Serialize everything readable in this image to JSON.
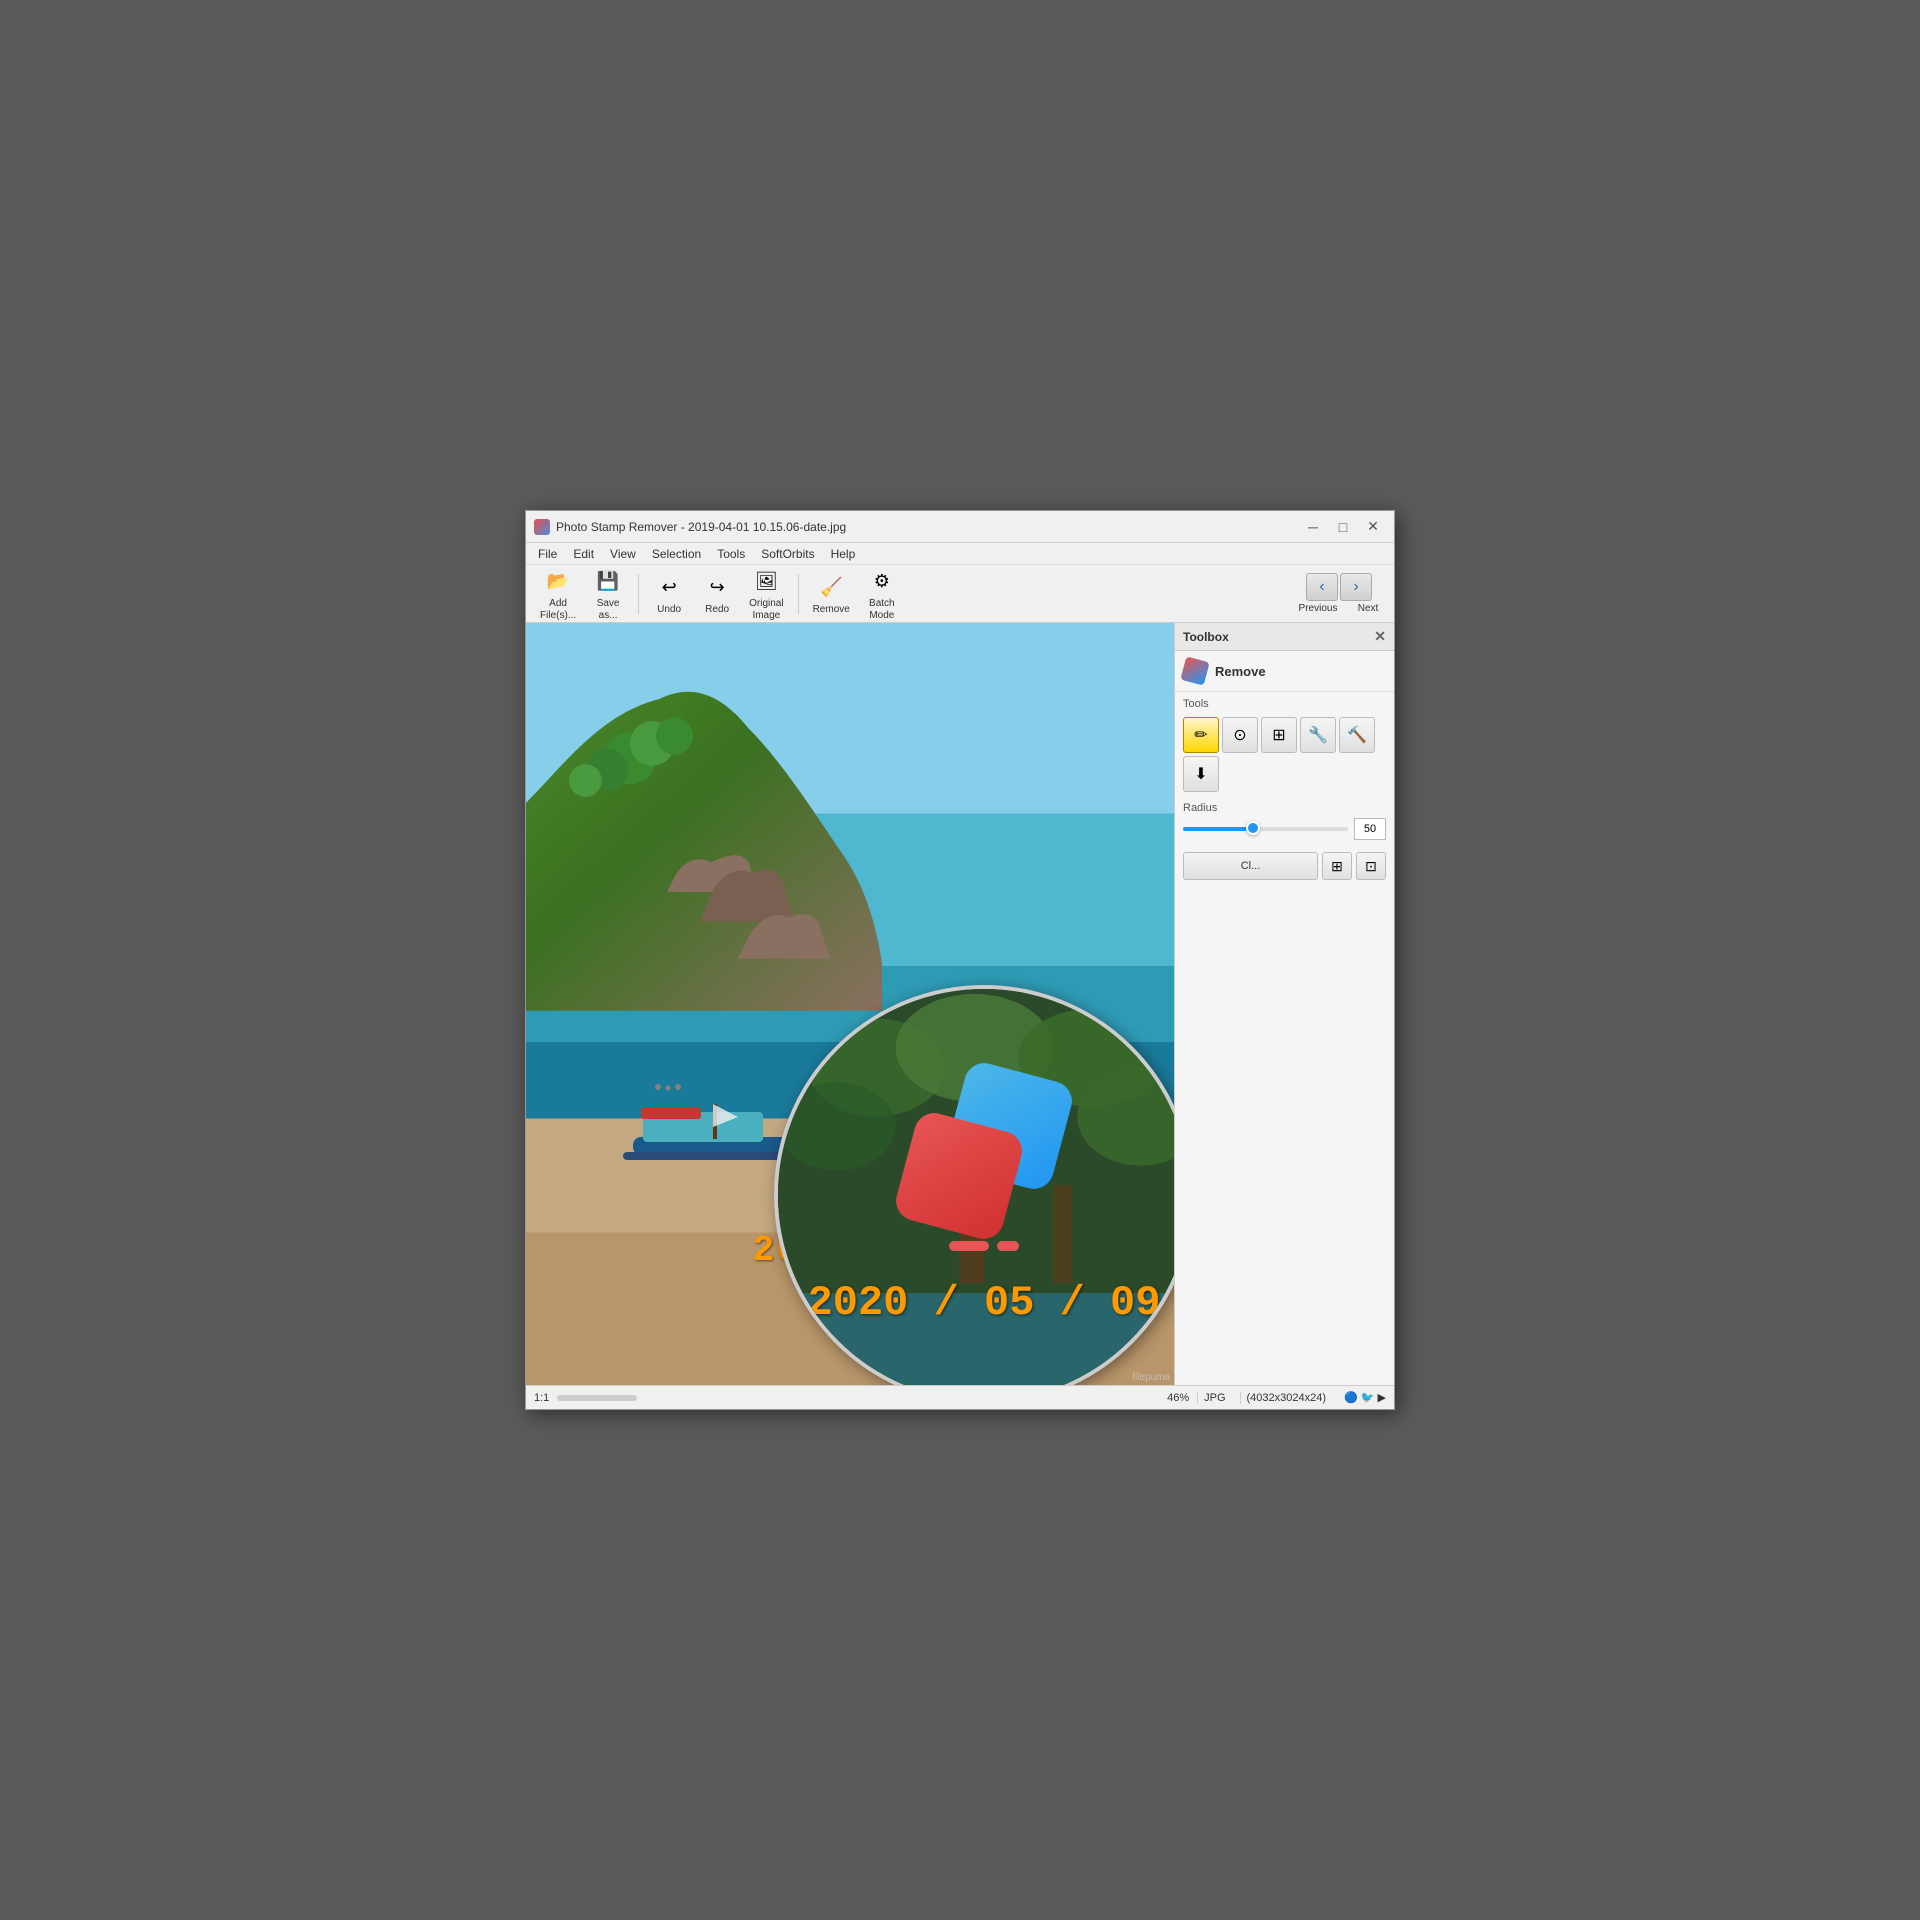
{
  "app": {
    "title": "Photo Stamp Remover - 2019-04-01 10.15.06-date.jpg",
    "icon": "eraser-icon"
  },
  "title_bar": {
    "minimize": "─",
    "maximize": "□",
    "close": "✕"
  },
  "menu": {
    "items": [
      "File",
      "Edit",
      "View",
      "Selection",
      "Tools",
      "SoftOrbits",
      "Help"
    ]
  },
  "toolbar": {
    "add_label": "Add\nFile(s)...",
    "save_label": "Save\nas...",
    "undo_label": "Undo",
    "redo_label": "Redo",
    "original_label": "Original\nImage",
    "remove_label": "Remove",
    "batch_label": "Batch\nMode",
    "previous_label": "Previous",
    "next_label": "Next"
  },
  "toolbox": {
    "title": "Toolbox",
    "remove_heading": "Remove",
    "tools_label": "Tools",
    "radius_label": "Radius",
    "radius_value": "50",
    "clear_btn": "Cl...",
    "tools": [
      {
        "name": "pencil",
        "symbol": "✏️",
        "active": true
      },
      {
        "name": "lasso",
        "symbol": "⭕",
        "active": false
      },
      {
        "name": "grid",
        "symbol": "⊞",
        "active": false
      },
      {
        "name": "fill",
        "symbol": "🔧",
        "active": false
      },
      {
        "name": "stamp",
        "symbol": "🔨",
        "active": false
      },
      {
        "name": "clone",
        "symbol": "⬇",
        "active": false
      }
    ]
  },
  "image": {
    "date_stamp": "2020 / 05 / 09",
    "date_stamp_partial": "2020 / 05 /"
  },
  "status_bar": {
    "zoom_icon": "zoom-icon",
    "zoom_level": "46%",
    "format": "JPG",
    "dimensions": "(4032x3024x24)",
    "watermark": "filepuma"
  },
  "zoom_circle": {
    "date": "2020 / 05 / 09"
  }
}
